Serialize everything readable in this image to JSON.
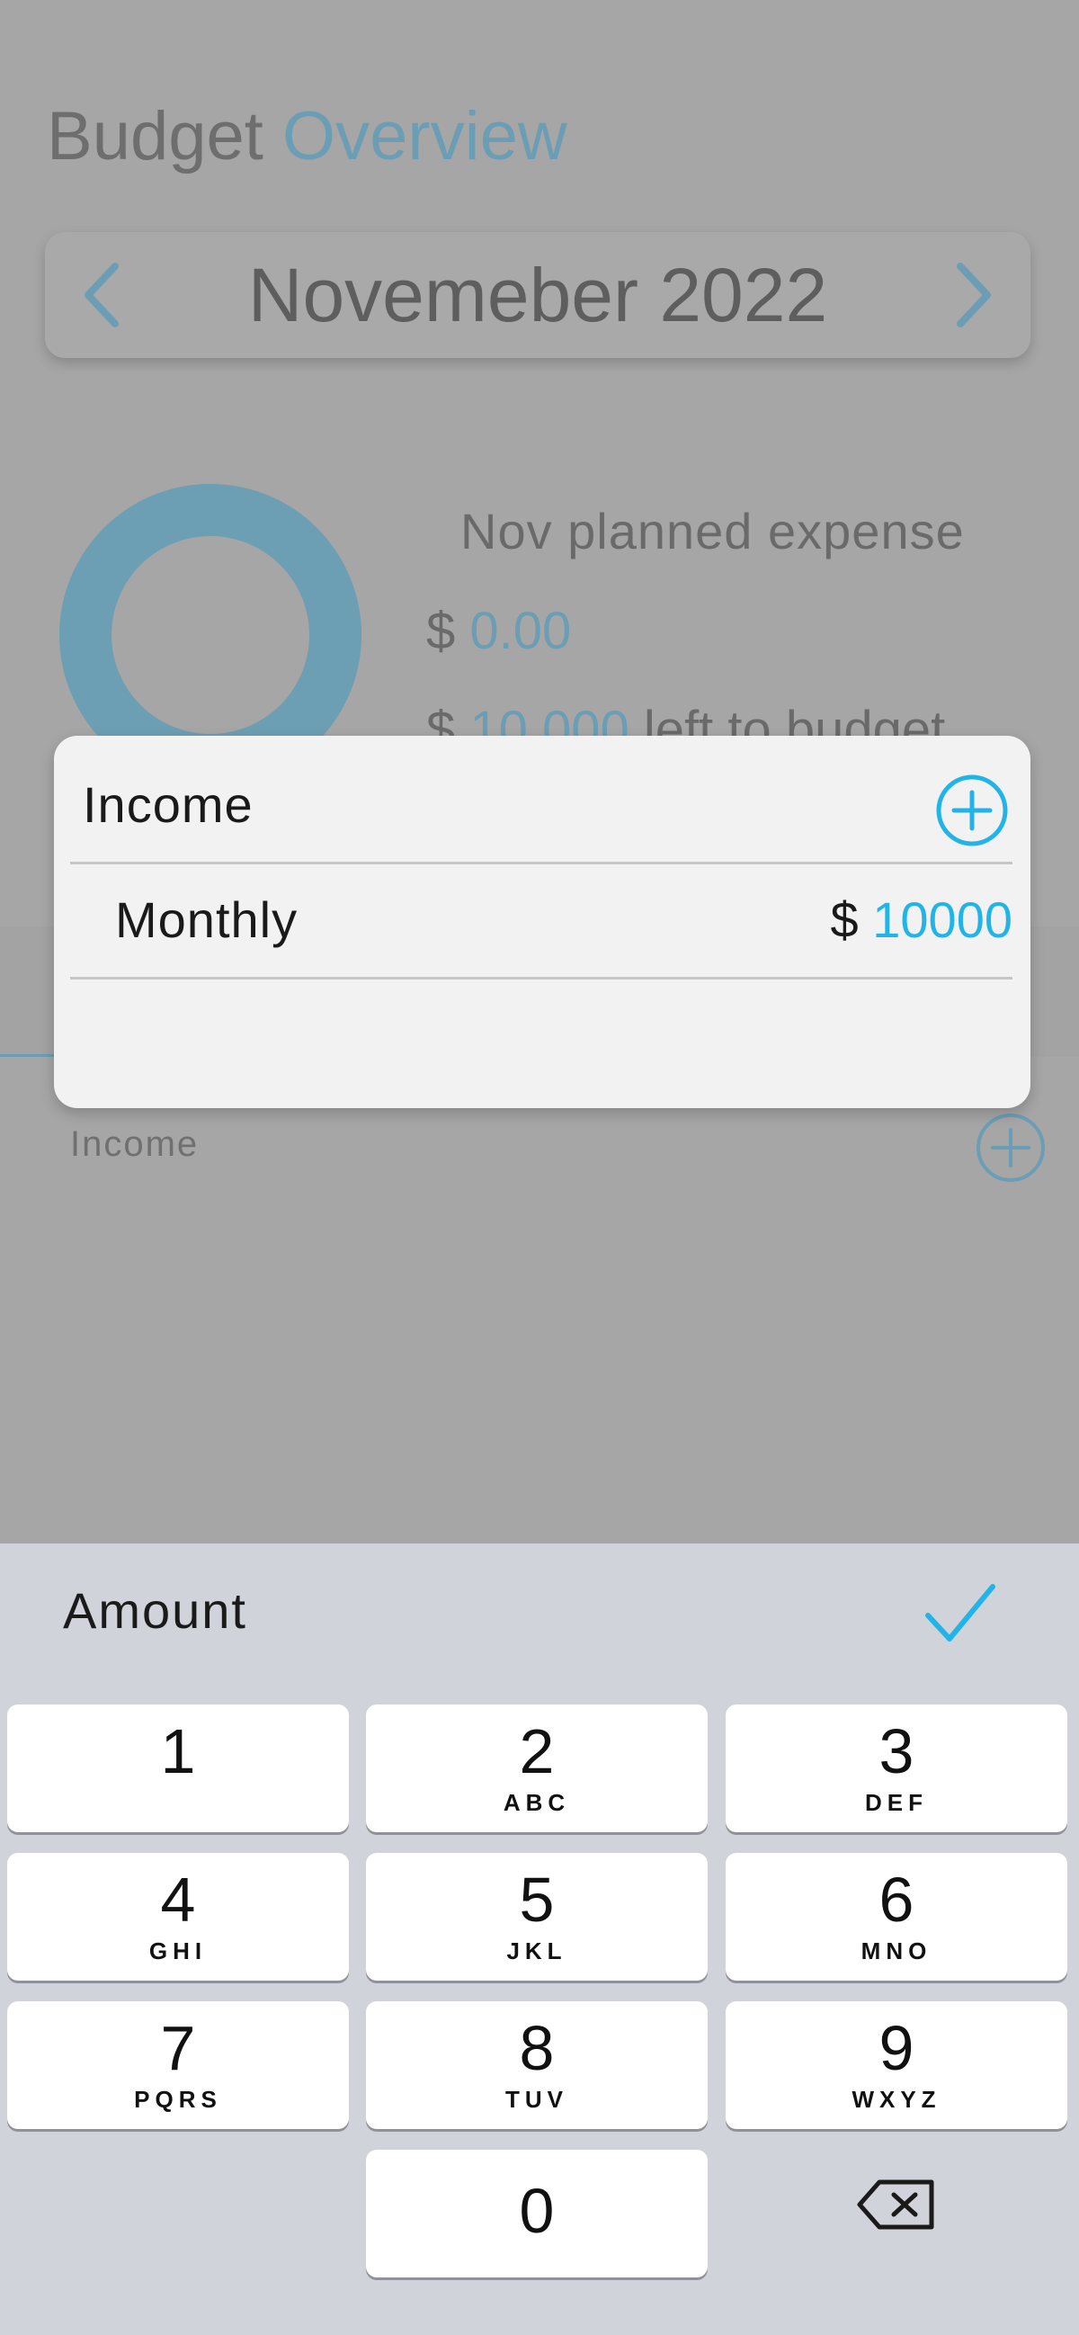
{
  "page": {
    "title_main": "Budget",
    "title_accent": "Overview",
    "month": "Novemeber 2022",
    "planned_label": "Nov planned expense",
    "planned_currency": "$",
    "planned_value": "0.00",
    "left_currency": "$",
    "left_value": "10,000",
    "left_suffix": "left to budget",
    "section_income": "Income"
  },
  "modal": {
    "title": "Income",
    "rows": [
      {
        "label": "Monthly",
        "currency": "$",
        "value": "10000"
      }
    ]
  },
  "keyboard": {
    "title": "Amount",
    "keys": [
      {
        "num": "1",
        "letters": ""
      },
      {
        "num": "2",
        "letters": "ABC"
      },
      {
        "num": "3",
        "letters": "DEF"
      },
      {
        "num": "4",
        "letters": "GHI"
      },
      {
        "num": "5",
        "letters": "JKL"
      },
      {
        "num": "6",
        "letters": "MNO"
      },
      {
        "num": "7",
        "letters": "PQRS"
      },
      {
        "num": "8",
        "letters": "TUV"
      },
      {
        "num": "9",
        "letters": "WXYZ"
      },
      {
        "num": "0",
        "letters": ""
      }
    ]
  },
  "icons": {
    "prev": "chevron-left-icon",
    "next": "chevron-right-icon",
    "add": "plus-circle-icon",
    "done": "checkmark-icon",
    "delete": "backspace-icon"
  },
  "colors": {
    "accent": "#22b4e6",
    "accent_dimmed": "#6b9eb5",
    "overlay": "#a6a6a6",
    "keyboard_bg": "#d0d3da"
  }
}
